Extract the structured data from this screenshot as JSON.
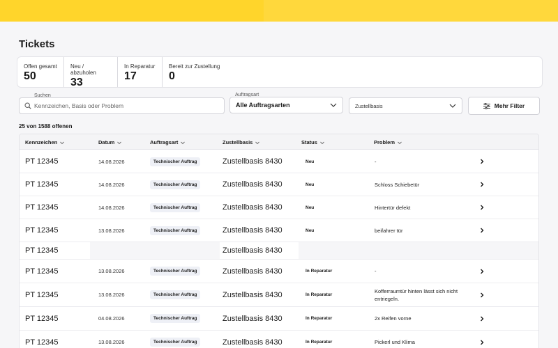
{
  "page": {
    "title": "Tickets"
  },
  "stats": [
    {
      "label": "Offen gesamt",
      "value": "50"
    },
    {
      "label": "Neu / abzuholen",
      "value": "33"
    },
    {
      "label": "In Reparatur",
      "value": "17"
    },
    {
      "label": "Bereit zur Zustellung",
      "value": "0"
    }
  ],
  "filters": {
    "search_label": "Suchen",
    "search_placeholder": "Kennzeichen, Basis oder Problem",
    "auftragsart_label": "Auftragsart",
    "auftragsart_value": "Alle Auftragsarten",
    "zustellbasis_value": "Zustellbasis",
    "more_filters": "Mehr Filter"
  },
  "count_text": "25 von 1588 offenen",
  "table": {
    "headers": [
      "Kennzeichen",
      "Datum",
      "Auftragsart",
      "Zustellbasis",
      "Status",
      "Problem"
    ],
    "rows": [
      {
        "kz": "PT 12345",
        "datum": "14.08.2026",
        "art": "Technischer Auftrag",
        "basis": "Zustellbasis 8430",
        "status": "Neu",
        "problem": "-"
      },
      {
        "kz": "PT 12345",
        "datum": "14.08.2026",
        "art": "Technischer Auftrag",
        "basis": "Zustellbasis 8430",
        "status": "Neu",
        "problem": "Schloss Schiebetür"
      },
      {
        "kz": "PT 12345",
        "datum": "14.08.2026",
        "art": "Technischer Auftrag",
        "basis": "Zustellbasis 8430",
        "status": "Neu",
        "problem": "Hintertür defekt"
      },
      {
        "kz": "PT 12345",
        "datum": "13.08.2026",
        "art": "Technischer Auftrag",
        "basis": "Zustellbasis 8430",
        "status": "Neu",
        "problem": "beifahrer tür"
      },
      {
        "kz": "PT 12345",
        "datum": "",
        "art": "",
        "basis": "Zustellbasis 8430",
        "status": "",
        "problem": ""
      },
      {
        "kz": "PT 12345",
        "datum": "13.08.2026",
        "art": "Technischer Auftrag",
        "basis": "Zustellbasis 8430",
        "status": "In Reparatur",
        "problem": "-"
      },
      {
        "kz": "PT 12345",
        "datum": "13.08.2026",
        "art": "Technischer Auftrag",
        "basis": "Zustellbasis 8430",
        "status": "In Reparatur",
        "problem": "Kofferraumtür hinten lässt sich nicht entriegeln."
      },
      {
        "kz": "PT 12345",
        "datum": "04.08.2026",
        "art": "Technischer Auftrag",
        "basis": "Zustellbasis 8430",
        "status": "In Reparatur",
        "problem": "2x Reifen vorne"
      },
      {
        "kz": "PT 12345",
        "datum": "13.08.2026",
        "art": "Technischer Auftrag",
        "basis": "Zustellbasis 8430",
        "status": "In Reparatur",
        "problem": "Pickerl und Klima"
      }
    ]
  },
  "colors": {
    "topbar": "#ffd83c",
    "background": "#f6f6f8",
    "badge": "#eef0f6"
  },
  "icons": {
    "search": "search-icon",
    "chevron": "chevron-down-icon",
    "filter": "sliders-icon",
    "row_arrow": "chevron-right-icon"
  }
}
